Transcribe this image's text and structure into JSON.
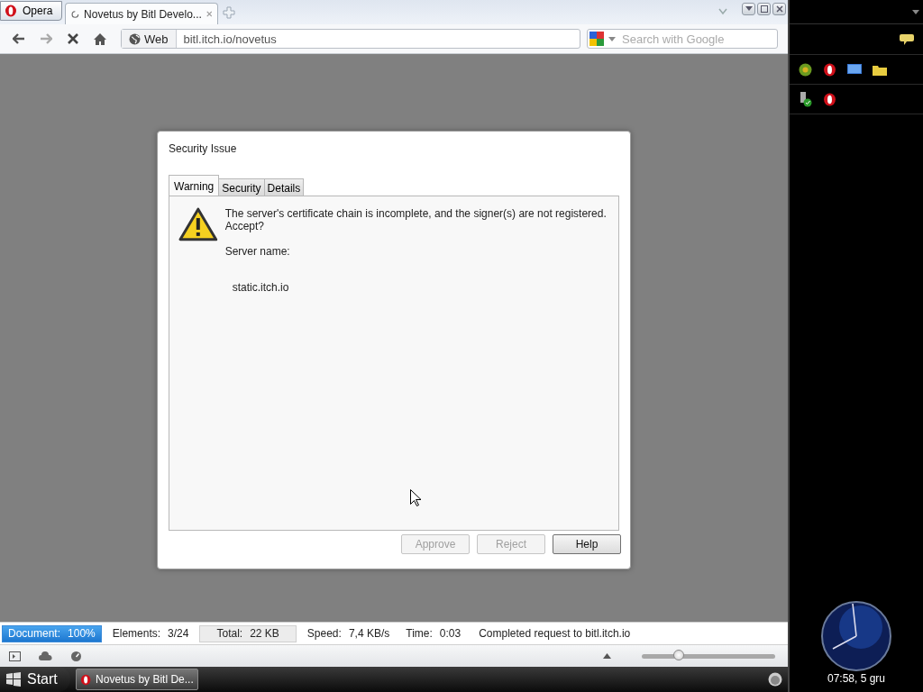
{
  "browser": {
    "menu_button": "Opera",
    "tabs": [
      {
        "title": "Novetus by Bitl Develo...",
        "selected": true,
        "loading": true
      }
    ],
    "address": {
      "badge": "Web",
      "url": "bitl.itch.io/novetus"
    },
    "search": {
      "placeholder": "Search with Google"
    }
  },
  "dialog": {
    "title": "Security Issue",
    "tabs": [
      {
        "label": "Warning",
        "selected": true
      },
      {
        "label": "Security",
        "selected": false
      },
      {
        "label": "Details",
        "selected": false
      }
    ],
    "message": "The server's certificate chain is incomplete, and the signer(s) are not registered. Accept?",
    "server_label": "Server name:",
    "server": "static.itch.io",
    "buttons": [
      {
        "label": "Approve",
        "disabled": true
      },
      {
        "label": "Reject",
        "disabled": true
      },
      {
        "label": "Help",
        "disabled": false
      }
    ]
  },
  "status_bar": {
    "items": [
      {
        "kind": "progress",
        "label": "Document:",
        "value": "100%",
        "level": 1
      },
      {
        "kind": "plain",
        "label": "Elements:",
        "value": "3/24"
      },
      {
        "kind": "boxed",
        "label": "Total:",
        "value": "22 KB"
      },
      {
        "kind": "plain",
        "label": "Speed:",
        "value": "7,4 KB/s"
      },
      {
        "kind": "plain",
        "label": "Time:",
        "value": "0:03"
      }
    ],
    "message": "Completed request to bitl.itch.io"
  },
  "zoom_slider": {
    "level": 0.28
  },
  "taskbar": {
    "start": "Start",
    "windows": [
      {
        "title": "Novetus by Bitl De...",
        "selected": true
      }
    ]
  },
  "sidebar": {
    "clock_time": "07:58, 5 gru"
  }
}
